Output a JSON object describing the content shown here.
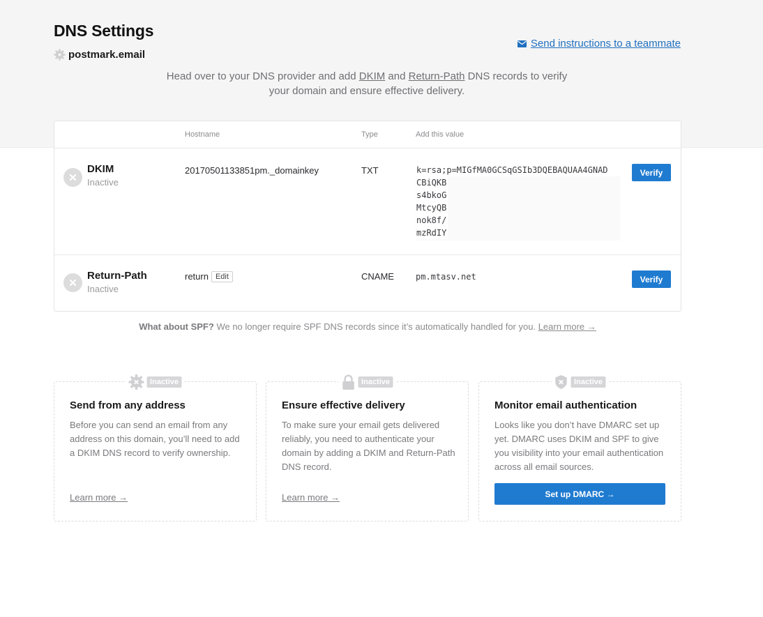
{
  "header": {
    "title": "DNS Settings",
    "domain": "postmark.email",
    "send_link": "Send instructions to a teammate",
    "intro_before": "Head over to your DNS provider and add ",
    "intro_dkim": "DKIM",
    "intro_and": " and ",
    "intro_return_path": "Return-Path",
    "intro_after": " DNS records to verify your domain and ensure effective delivery."
  },
  "table": {
    "col_hostname": "Hostname",
    "col_type": "Type",
    "col_value": "Add this value",
    "rows": [
      {
        "name": "DKIM",
        "status": "Inactive",
        "hostname": "20170501133851pm._domainkey",
        "type": "TXT",
        "value_lines": [
          "k=rsa;p=MIGfMA0GCSqGSIb3DQEBAQUAA4GNAD",
          "CBiQKB",
          "s4bkoG",
          "MtcyQB",
          "nok8f/",
          "mzRdIY"
        ],
        "verify_label": "Verify"
      },
      {
        "name": "Return-Path",
        "status": "Inactive",
        "hostname": "return",
        "edit_label": "Edit",
        "type": "CNAME",
        "value": "pm.mtasv.net",
        "verify_label": "Verify"
      }
    ]
  },
  "spf": {
    "question": "What about SPF?",
    "text": " We no longer require SPF DNS records since it’s automatically handled for you. ",
    "learn": "Learn more →"
  },
  "features": [
    {
      "badge": "Inactive",
      "icon": "gear-icon",
      "title": "Send from any address",
      "desc": "Before you can send an email from any address on this domain, you’ll need to add a DKIM DNS record to verify ownership.",
      "learn": "Learn more →"
    },
    {
      "badge": "Inactive",
      "icon": "lock-icon",
      "title": "Ensure effective delivery",
      "desc": "To make sure your email gets delivered reliably, you need to authenticate your domain by adding a DKIM and Return-Path DNS record.",
      "learn": "Learn more →"
    },
    {
      "badge": "Inactive",
      "icon": "shield-icon",
      "title": "Monitor email authentication",
      "desc": "Looks like you don’t have DMARC set up yet. DMARC uses DKIM and SPF to give you visibility into your email authentication across all email sources.",
      "button": "Set up DMARC →"
    }
  ],
  "colors": {
    "accent": "#1f7bd0",
    "link": "#1f6fbf",
    "inactive_badge": "#d6d6d8"
  }
}
